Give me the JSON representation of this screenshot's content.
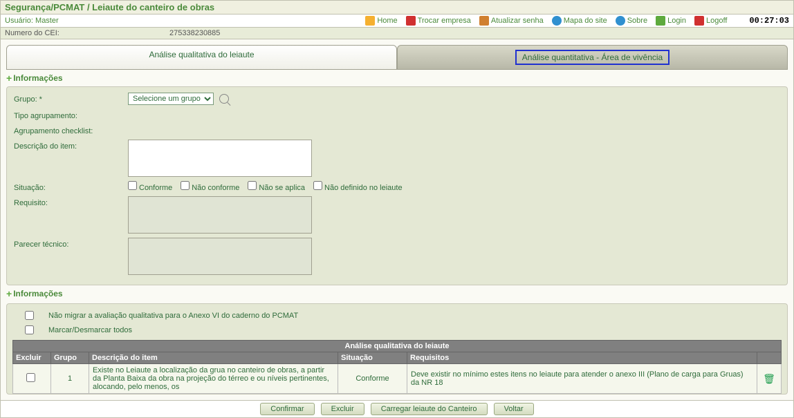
{
  "breadcrumb": "Segurança/PCMAT / Leiaute do canteiro de obras",
  "user": {
    "label": "Usuário:",
    "name": "Master"
  },
  "nav": {
    "home": "Home",
    "trocar": "Trocar empresa",
    "atualizar": "Atualizar senha",
    "mapa": "Mapa do site",
    "sobre": "Sobre",
    "login": "Login",
    "logoff": "Logoff",
    "clock": "00:27:03"
  },
  "stray": {
    "label": "Numero do CEI:",
    "value": "275338230885"
  },
  "tabs": {
    "leftLabel": "Análise qualitativa do leiaute",
    "rightLabel": "Análise quantitativa - Área de vivência"
  },
  "section1": {
    "title": "Informações"
  },
  "form": {
    "grupo": {
      "label": "Grupo: *",
      "option": "Selecione um grupo"
    },
    "tipo": {
      "label": "Tipo agrupamento:"
    },
    "agrup": {
      "label": "Agrupamento checklist:"
    },
    "descItem": {
      "label": "Descrição do item:"
    },
    "situacao": {
      "label": "Situação:",
      "opts": [
        "Conforme",
        "Não conforme",
        "Não se aplica",
        "Não definido no leiaute"
      ]
    },
    "requisito": {
      "label": "Requisito:"
    },
    "parecer": {
      "label": "Parecer técnico:"
    }
  },
  "section2": {
    "title": "Informações"
  },
  "opts": {
    "naoMigrar": "Não migrar a avaliação qualitativa para o Anexo VI do caderno do PCMAT",
    "marcarTodos": "Marcar/Desmarcar todos"
  },
  "tableTitle": "Análise qualitativa do leiaute",
  "cols": {
    "excluir": "Excluir",
    "grupo": "Grupo",
    "desc": "Descrição do item",
    "situacao": "Situação",
    "req": "Requisitos"
  },
  "row1": {
    "grupo": "1",
    "desc": "Existe no Leiaute a localização da grua no canteiro de obras, a partir da Planta Baixa da obra na projeção do térreo e ou níveis pertinentes, alocando, pelo menos, os",
    "situacao": "Conforme",
    "req": "Deve existir no mínimo estes itens no leiaute para atender o anexo III (Plano de carga para Gruas) da NR 18"
  },
  "buttons": {
    "confirmar": "Confirmar",
    "excluir": "Excluir",
    "carregar": "Carregar leiaute do Canteiro",
    "voltar": "Voltar"
  }
}
